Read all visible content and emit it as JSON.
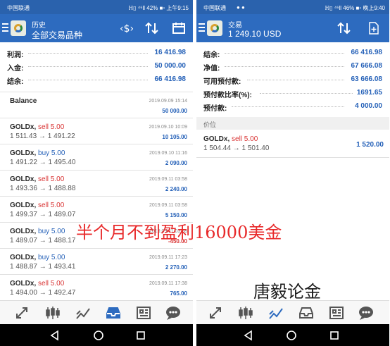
{
  "left": {
    "statusbar": {
      "carrier": "中国联通",
      "right": "ℍ▯ ⁴⁶ll 42% ■▫ 上午9:15"
    },
    "header": {
      "title": "历史",
      "subtitle": "全部交易品种"
    },
    "summary": [
      {
        "label": "利润:",
        "value": "16 416.98"
      },
      {
        "label": "入金:",
        "value": "50 000.00"
      },
      {
        "label": "结余:",
        "value": "66 416.98"
      }
    ],
    "balance": {
      "label": "Balance",
      "time": "2019.09.09 15:14",
      "amount": "50 000.00"
    },
    "deals": [
      {
        "symbol": "GOLDx,",
        "side": "sell 5.00",
        "prices": "1 511.43 → 1 491.22",
        "time": "2019.09.10 10:09",
        "profit": "10 105.00"
      },
      {
        "symbol": "GOLDx,",
        "side": "buy 5.00",
        "prices": "1 491.22 → 1 495.40",
        "time": "2019.09.10 11:16",
        "profit": "2 090.00"
      },
      {
        "symbol": "GOLDx,",
        "side": "sell 5.00",
        "prices": "1 493.36 → 1 488.88",
        "time": "2019.09.11 03:58",
        "profit": "2 240.00"
      },
      {
        "symbol": "GOLDx,",
        "side": "sell 5.00",
        "prices": "1 499.37 → 1 489.07",
        "time": "2019.09.11 03:58",
        "profit": "5 150.00"
      },
      {
        "symbol": "GOLDx,",
        "side": "buy 5.00",
        "prices": "1 489.07 → 1 488.17",
        "time": "2019.09.11 03:58",
        "profit": "-450.00"
      },
      {
        "symbol": "GOLDx,",
        "side": "buy 5.00",
        "prices": "1 488.87 → 1 493.41",
        "time": "2019.09.11 17:23",
        "profit": "2 270.00"
      },
      {
        "symbol": "GOLDx,",
        "side": "sell 5.00",
        "prices": "1 494.00 → 1 492.47",
        "time": "2019.09.11 17:38",
        "profit": "765.00"
      }
    ]
  },
  "right": {
    "statusbar": {
      "carrier": "中国联通",
      "carrier_icons": "● ●",
      "right": "ℍ▯ ⁴⁶ll 46% ■▫ 晚上9:40"
    },
    "header": {
      "title": "交易",
      "subtitle": "1 249.10 USD"
    },
    "summary": [
      {
        "label": "结余:",
        "value": "66 416.98"
      },
      {
        "label": "净值:",
        "value": "67 666.08"
      },
      {
        "label": "可用预付款:",
        "value": "63 666.08"
      },
      {
        "label": "预付款比率(%):",
        "value": "1691.65"
      },
      {
        "label": "预付款:",
        "value": "4 000.00"
      }
    ],
    "section": "价位",
    "position": {
      "symbol": "GOLDx,",
      "side": "sell 5.00",
      "prices": "1 504.44 → 1 501.40",
      "profit": "1 520.00"
    }
  },
  "overlay": {
    "main": "半个月不到盈利16000美金",
    "brand": "唐毅论金"
  },
  "icons": {
    "tabs": [
      "arrows-icon",
      "candlesticks-icon",
      "chart-icon",
      "inbox-icon",
      "news-icon",
      "chat-icon"
    ],
    "header_left": [
      "currency-switch-icon",
      "sort-icon",
      "calendar-icon"
    ],
    "header_right": [
      "sort-icon",
      "add-order-icon"
    ]
  },
  "colors": {
    "statusbar": "#2a62ad",
    "header": "#2d6bbf",
    "positive": "#2561b8",
    "negative": "#d93535",
    "overlay": "#e8292a"
  }
}
